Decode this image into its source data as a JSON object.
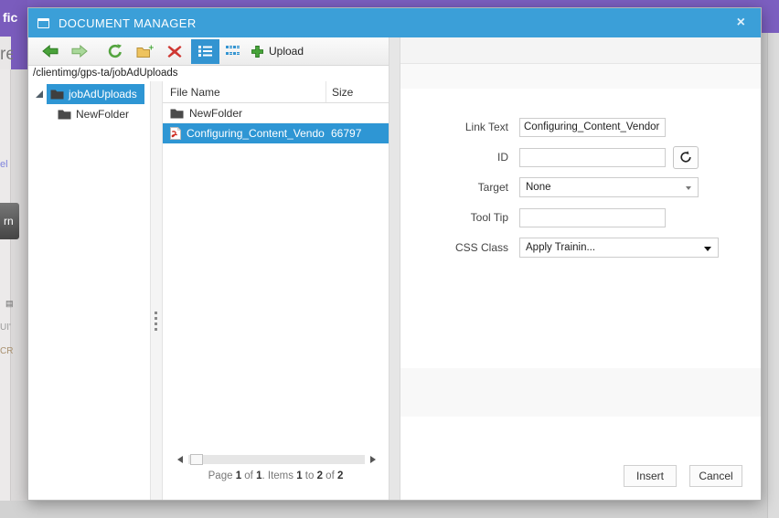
{
  "window": {
    "title": "DOCUMENT MANAGER",
    "close_glyph": "×"
  },
  "colors": {
    "titlebar_blue": "#3b9fd8",
    "selection_blue": "#2e96d4",
    "toolbar_active_blue": "#3394d1",
    "banner_purple": "#7c5fc1",
    "folder_yellow": "#eec35e",
    "delete_red": "#cf3732",
    "action_green": "#46a339"
  },
  "toolbar": {
    "icons": [
      "back-icon",
      "forward-icon",
      "refresh-icon",
      "new-folder-icon",
      "delete-icon",
      "list-view-icon",
      "grid-view-icon",
      "upload-icon"
    ],
    "active_view": "list-view",
    "upload_label": "Upload"
  },
  "path": {
    "value": "/clientimg/gps-ta/jobAdUploads"
  },
  "tree": {
    "nodes": [
      {
        "label": "jobAdUploads",
        "selected": true,
        "expanded": true
      },
      {
        "label": "NewFolder",
        "selected": false
      }
    ]
  },
  "grid": {
    "columns": [
      "File Name",
      "Size"
    ],
    "rows": [
      {
        "name": "NewFolder",
        "size": "",
        "type": "folder",
        "selected": false
      },
      {
        "name": "Configuring_Content_Vendo",
        "size": "66797",
        "type": "pdf",
        "selected": true
      }
    ]
  },
  "pager": {
    "p0": "Page ",
    "p1": "1",
    "p2": " of ",
    "p3": "1",
    "p4": ". Items ",
    "p5": "1",
    "p6": " to ",
    "p7": "2",
    "p8": " of ",
    "p9": "2"
  },
  "form": {
    "link_text": {
      "label": "Link Text",
      "value": "Configuring_Content_Vendor"
    },
    "id": {
      "label": "ID",
      "value": ""
    },
    "target": {
      "label": "Target",
      "value": "None"
    },
    "tooltip": {
      "label": "Tool Tip",
      "value": ""
    },
    "css_class": {
      "label": "CSS Class",
      "value": "Apply Trainin..."
    }
  },
  "footer": {
    "insert_label": "Insert",
    "cancel_label": "Cancel"
  },
  "background": {
    "fragments": {
      "fic": "fic",
      "re": "re",
      "el": "el",
      "rn": "rn",
      "doc": "▤",
      "ui": "UI'",
      "cri": "CRI"
    }
  }
}
